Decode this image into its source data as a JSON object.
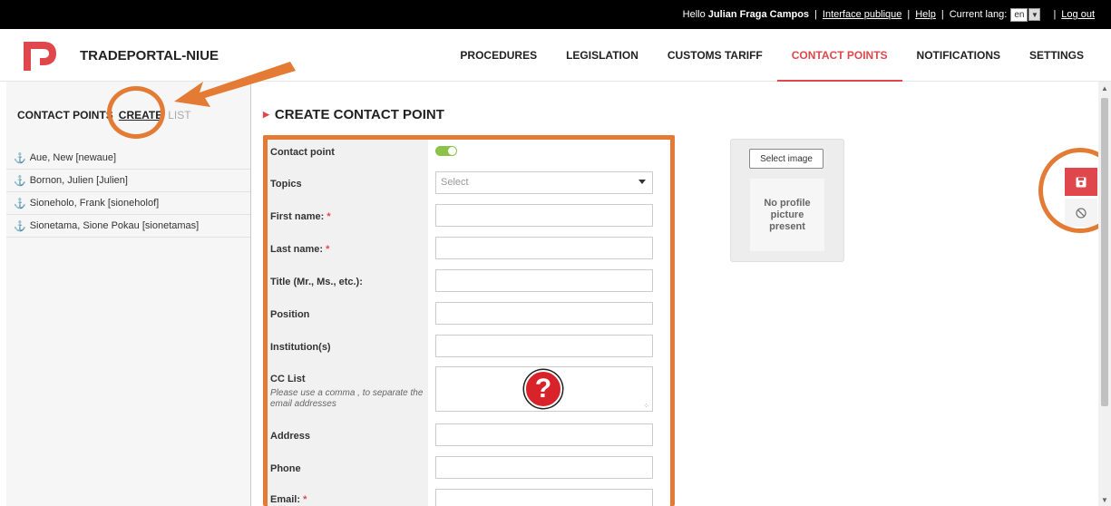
{
  "topbar": {
    "greeting": "Hello",
    "user_name": "Julian Fraga Campos",
    "public_interface": "Interface publique",
    "help": "Help",
    "current_lang_label": "Current lang:",
    "lang_value": "en",
    "logout": "Log out"
  },
  "header": {
    "brand": "TRADEPORTAL-NIUE",
    "logo_color": "#e0474c",
    "nav": [
      "PROCEDURES",
      "LEGISLATION",
      "CUSTOMS TARIFF",
      "CONTACT POINTS",
      "NOTIFICATIONS",
      "SETTINGS"
    ],
    "active_nav": "CONTACT POINTS"
  },
  "sidebar": {
    "title": "CONTACT POINTS",
    "create": "CREATE",
    "list": "LIST",
    "items": [
      "Aue, New [newaue]",
      "Bornon, Julien [Julien]",
      "Sioneholo, Frank [sioneholof]",
      "Sionetama, Sione Pokau [sionetamas]"
    ]
  },
  "main": {
    "title": "CREATE CONTACT POINT",
    "fields": {
      "contact_point": "Contact point",
      "topics": "Topics",
      "topics_placeholder": "Select",
      "first_name": "First name:",
      "last_name": "Last name:",
      "title": "Title (Mr., Ms., etc.):",
      "position": "Position",
      "institutions": "Institution(s)",
      "cc_list": "CC List",
      "cc_hint": "Please use a comma , to separate the email addresses",
      "address": "Address",
      "phone": "Phone",
      "email": "Email:",
      "required_mark": "*"
    },
    "contact_point_enabled": true
  },
  "image_panel": {
    "button": "Select image",
    "placeholder": "No profile picture present"
  },
  "actions": {
    "save_icon": "floppy-disk-icon",
    "cancel_icon": "cancel-circle-icon"
  },
  "annotation": {
    "question_mark": "?",
    "color": "#e47b35"
  }
}
